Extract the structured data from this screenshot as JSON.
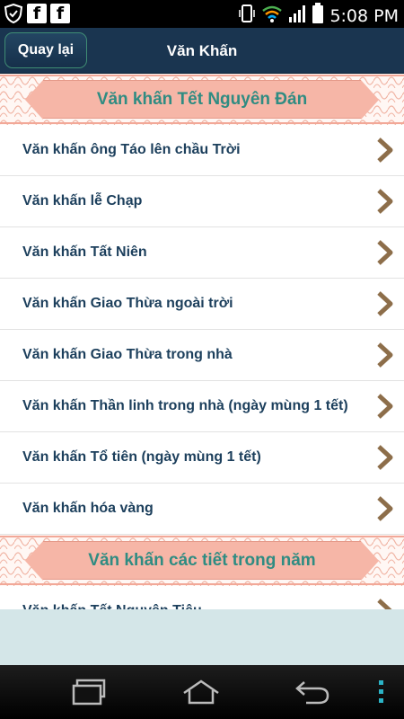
{
  "status_bar": {
    "time": "5:08 PM",
    "left_icons": [
      "shield-notification-icon",
      "facebook-icon",
      "facebook-icon"
    ],
    "right_icons": [
      "vibrate-icon",
      "wifi-icon",
      "signal-icon",
      "battery-icon"
    ]
  },
  "header": {
    "back_label": "Quay lại",
    "title": "Văn Khấn"
  },
  "sections": [
    {
      "title": "Văn khấn Tết Nguyên Đán",
      "items": [
        "Văn khấn ông Táo lên chầu Trời",
        "Văn khấn lễ Chạp",
        "Văn khấn Tất Niên",
        "Văn khấn Giao Thừa ngoài trời",
        "Văn khấn Giao Thừa trong nhà",
        "Văn khấn Thần linh trong nhà (ngày mùng 1 tết)",
        "Văn khấn Tổ tiên (ngày mùng 1 tết)",
        "Văn khấn hóa vàng"
      ]
    },
    {
      "title": "Văn khấn các tiết trong năm",
      "items": [
        "Văn khấn Tết Nguyên Tiêu"
      ]
    }
  ],
  "nav_bar": [
    "recent-apps-icon",
    "home-icon",
    "back-icon",
    "menu-icon"
  ],
  "colors": {
    "app_bar": "#1a3550",
    "back_button_border": "#3f8c74",
    "section_banner": "#f6b6a7",
    "section_title": "#2f8c82",
    "item_text": "#1c3f5c",
    "chevron": "#8d6e4a",
    "empty_area": "#d4e6e8"
  }
}
